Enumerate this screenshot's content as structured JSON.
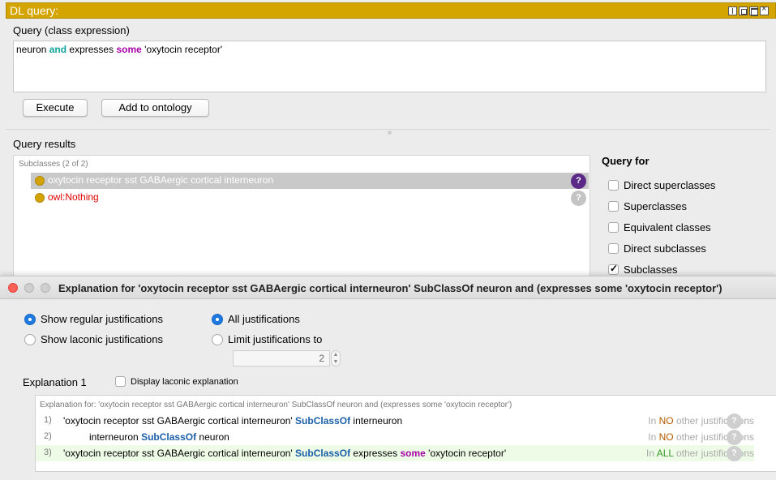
{
  "panel": {
    "title": "DL query:",
    "query_label": "Query (class expression)",
    "query_parts": [
      "neuron",
      "and",
      "expresses",
      "some",
      "'oxytocin receptor'"
    ],
    "execute_label": "Execute",
    "add_label": "Add to ontology",
    "results_label": "Query results",
    "results_header": "Subclasses (2 of 2)",
    "results": [
      {
        "label": "oxytocin receptor sst GABAergic cortical interneuron",
        "selected": true
      },
      {
        "label": "owl:Nothing",
        "selected": false
      }
    ],
    "query_for_title": "Query for",
    "query_for": [
      {
        "label": "Direct superclasses",
        "checked": false
      },
      {
        "label": "Superclasses",
        "checked": false
      },
      {
        "label": "Equivalent classes",
        "checked": false
      },
      {
        "label": "Direct subclasses",
        "checked": false
      },
      {
        "label": "Subclasses",
        "checked": true
      }
    ]
  },
  "dialog": {
    "title": "Explanation for 'oxytocin receptor sst GABAergic cortical interneuron' SubClassOf neuron and (expresses some 'oxytocin receptor')",
    "radio_regular": "Show regular justifications",
    "radio_laconic": "Show laconic justifications",
    "radio_all": "All justifications",
    "radio_limit": "Limit justifications to",
    "limit_value": "2",
    "explanation_label": "Explanation 1",
    "display_laconic": "Display laconic explanation",
    "expl_header": "Explanation for: 'oxytocin receptor sst GABAergic cortical interneuron' SubClassOf neuron and (expresses some 'oxytocin receptor')",
    "axioms": [
      {
        "num": "1)",
        "a": "'oxytocin receptor sst GABAergic cortical interneuron'",
        "k": "SubClassOf",
        "b": "interneuron",
        "c": "",
        "d": "",
        "info_in": "In",
        "info_q": "NO",
        "info_rest": "other justifications"
      },
      {
        "num": "2)",
        "a": "interneuron",
        "k": "SubClassOf",
        "b": "neuron",
        "c": "",
        "d": "",
        "info_in": "In",
        "info_q": "NO",
        "info_rest": "other justifications"
      },
      {
        "num": "3)",
        "a": "'oxytocin receptor sst GABAergic cortical interneuron'",
        "k": "SubClassOf",
        "b": "expresses",
        "c": "some",
        "d": "'oxytocin receptor'",
        "info_in": "In",
        "info_q": "ALL",
        "info_rest": "other justifications"
      }
    ],
    "question_mark": "?"
  },
  "colors": {
    "title_bar": "#d4a400",
    "and_keyword": "#0fa39b",
    "some_keyword": "#a700a7",
    "subclassof_keyword": "#1b5fa8",
    "selected_badge": "#5b2a86",
    "nothing_text": "#e00000"
  }
}
